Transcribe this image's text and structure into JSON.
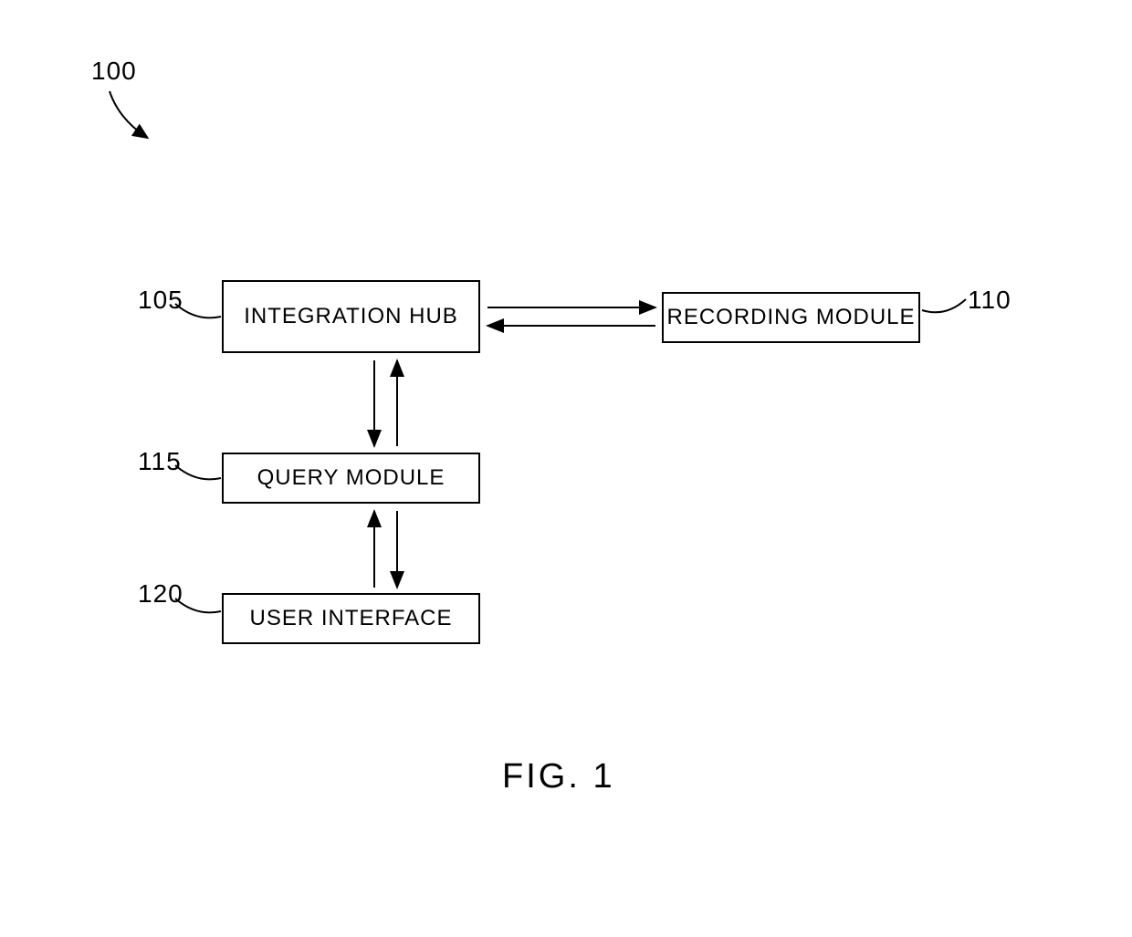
{
  "figure": {
    "caption": "FIG. 1",
    "system_ref": "100"
  },
  "blocks": {
    "integration_hub": {
      "label": "INTEGRATION HUB",
      "ref": "105"
    },
    "recording_module": {
      "label": "RECORDING MODULE",
      "ref": "110"
    },
    "query_module": {
      "label": "QUERY MODULE",
      "ref": "115"
    },
    "user_interface": {
      "label": "USER INTERFACE",
      "ref": "120"
    }
  }
}
